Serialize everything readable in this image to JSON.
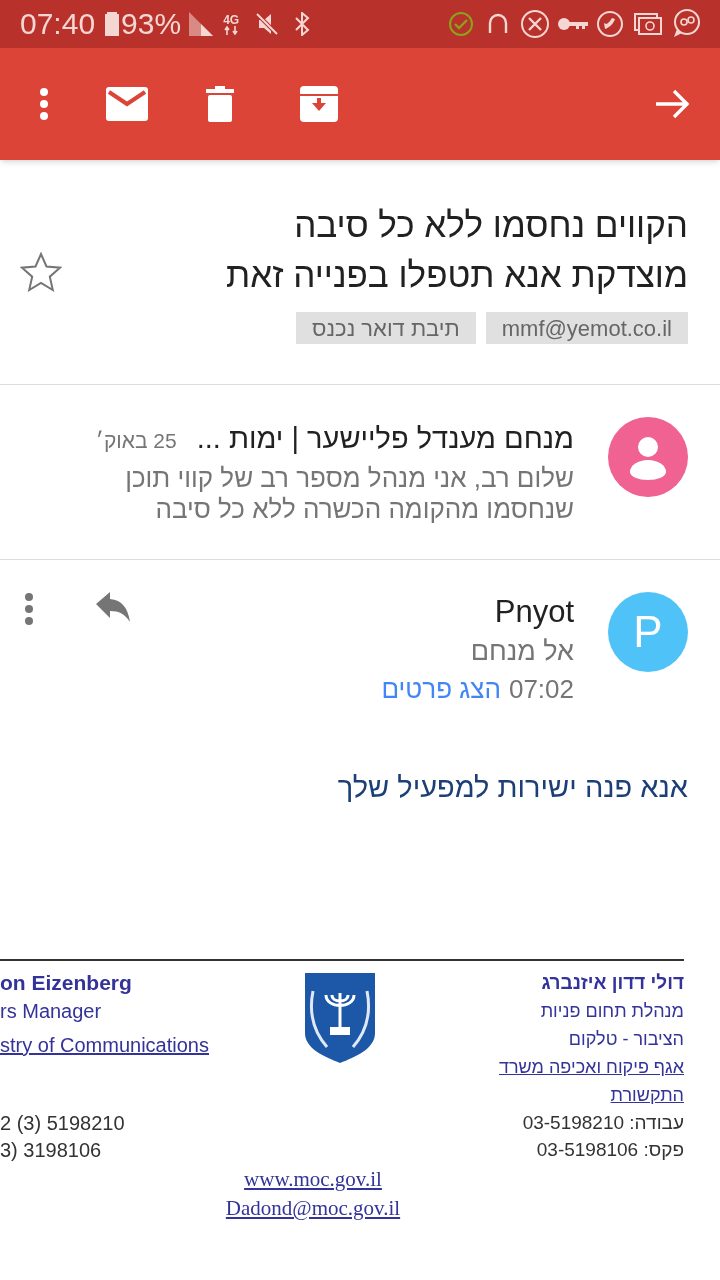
{
  "status_bar": {
    "time": "07:40",
    "battery": "93%",
    "network": "4G"
  },
  "subject": {
    "lines": [
      "הקווים נחסמו ללא כל סיבה",
      "מוצדקת אנא תטפלו בפנייה זאת"
    ],
    "starred": false
  },
  "labels": [
    "mmf@yemot.co.il",
    "תיבת דואר נכנס"
  ],
  "thread": [
    {
      "sender": "מנחם מענדל פליישער | ימות ...",
      "date": "25 באוק׳",
      "snippet": "שלום רב, אני מנהל מספר רב של קווי תוכן שנחסמו מהקומה הכשרה ללא כל סיבה"
    }
  ],
  "message": {
    "sender": "Pnyot",
    "avatar_letter": "P",
    "to": "אל מנחם",
    "time": "07:02",
    "details_link": "הצג פרטים",
    "body": "אנא פנה ישירות למפעיל שלך"
  },
  "signature": {
    "hebrew": {
      "name": "דולי דדון איזנברג",
      "lines": [
        "מנהלת תחום פניות",
        "הציבור - טלקום"
      ],
      "link": "אגף פיקוח ואכיפה משרד התקשורת",
      "phones": [
        "עבודה: 03-5198210",
        "פקס: 03-5198106"
      ]
    },
    "english": {
      "name": "on Eizenberg",
      "title": "rs Manager",
      "link": "stry of Communications",
      "phones": [
        "2 (3) 5198210",
        "3) 3198106"
      ]
    },
    "links": [
      "www.moc.gov.il",
      "Dadond@moc.gov.il"
    ]
  }
}
